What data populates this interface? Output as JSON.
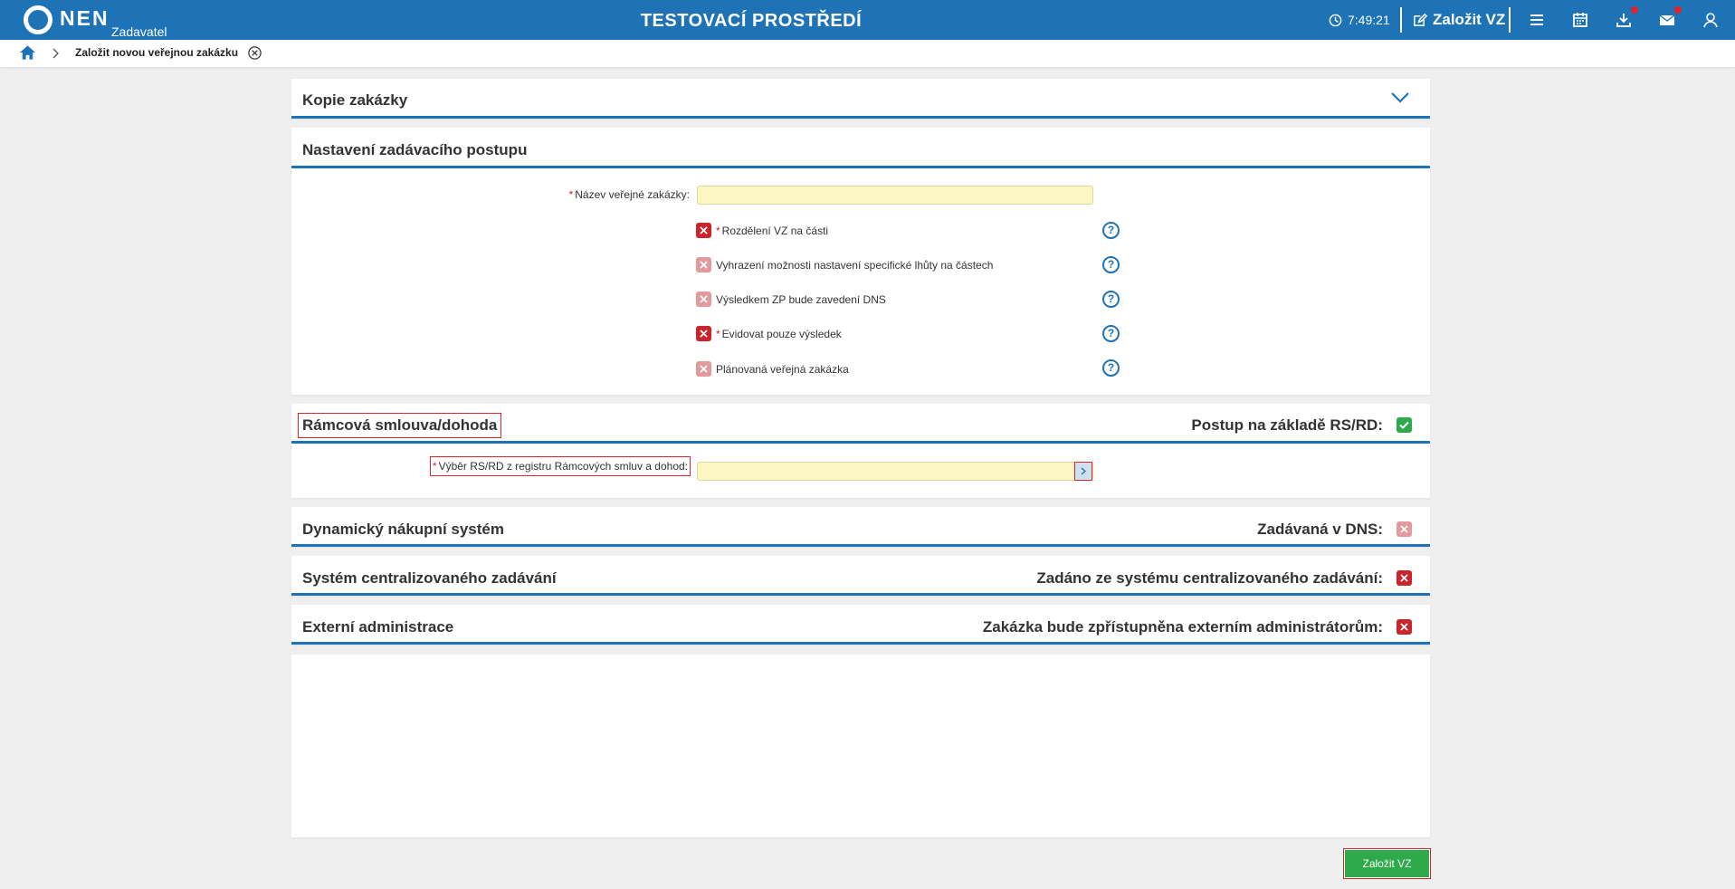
{
  "header": {
    "logo_text": "NEN",
    "logo_sub": "Zadavatel",
    "env_title": "TESTOVACÍ PROSTŘEDÍ",
    "clock": "7:49:21",
    "new_vz_label": "Založit VZ"
  },
  "breadcrumb": {
    "current": "Založit novou veřejnou zakázku"
  },
  "sections": {
    "kopie": {
      "title": "Kopie zakázky"
    },
    "nastaveni": {
      "title": "Nastavení zadávacího postupu",
      "name_label": "Název veřejné zakázky:",
      "name_value": "",
      "options": [
        {
          "label": "Rozdělení VZ na části",
          "required": true,
          "state": "off"
        },
        {
          "label": "Vyhrazení možnosti nastavení specifické lhůty na částech",
          "required": false,
          "state": "disabled"
        },
        {
          "label": "Výsledkem ZP bude zavedení DNS",
          "required": false,
          "state": "disabled"
        },
        {
          "label": "Evidovat pouze výsledek",
          "required": true,
          "state": "off"
        },
        {
          "label": "Plánovaná veřejná zakázka",
          "required": false,
          "state": "disabled"
        }
      ]
    },
    "ramcova": {
      "title": "Rámcová smlouva/dohoda",
      "right_label": "Postup na základě RS/RD:",
      "select_label": "Výběr RS/RD z registru Rámcových smluv a dohod:",
      "select_value": ""
    },
    "dns": {
      "title": "Dynamický nákupní systém",
      "right_label": "Zadávaná v DNS:"
    },
    "central": {
      "title": "Systém centralizovaného zadávání",
      "right_label": "Zadáno ze systému centralizovaného zadávání:"
    },
    "externi": {
      "title": "Externí administrace",
      "right_label": "Zakázka bude zpřístupněna externím administrátorům:"
    }
  },
  "actions": {
    "submit_label": "Založit VZ"
  },
  "colors": {
    "brand": "#1e73b7",
    "required": "#d0212a",
    "success": "#2eaa4b",
    "field_bg": "#fdf7c4"
  },
  "icons": [
    "clock-icon",
    "edit-icon",
    "menu-icon",
    "calendar-icon",
    "download-icon",
    "mail-icon",
    "user-icon",
    "home-icon",
    "chevron-right-icon",
    "close-circle-icon",
    "chevron-down-icon",
    "help-icon",
    "checkbox-cross-icon",
    "checkbox-check-icon"
  ]
}
